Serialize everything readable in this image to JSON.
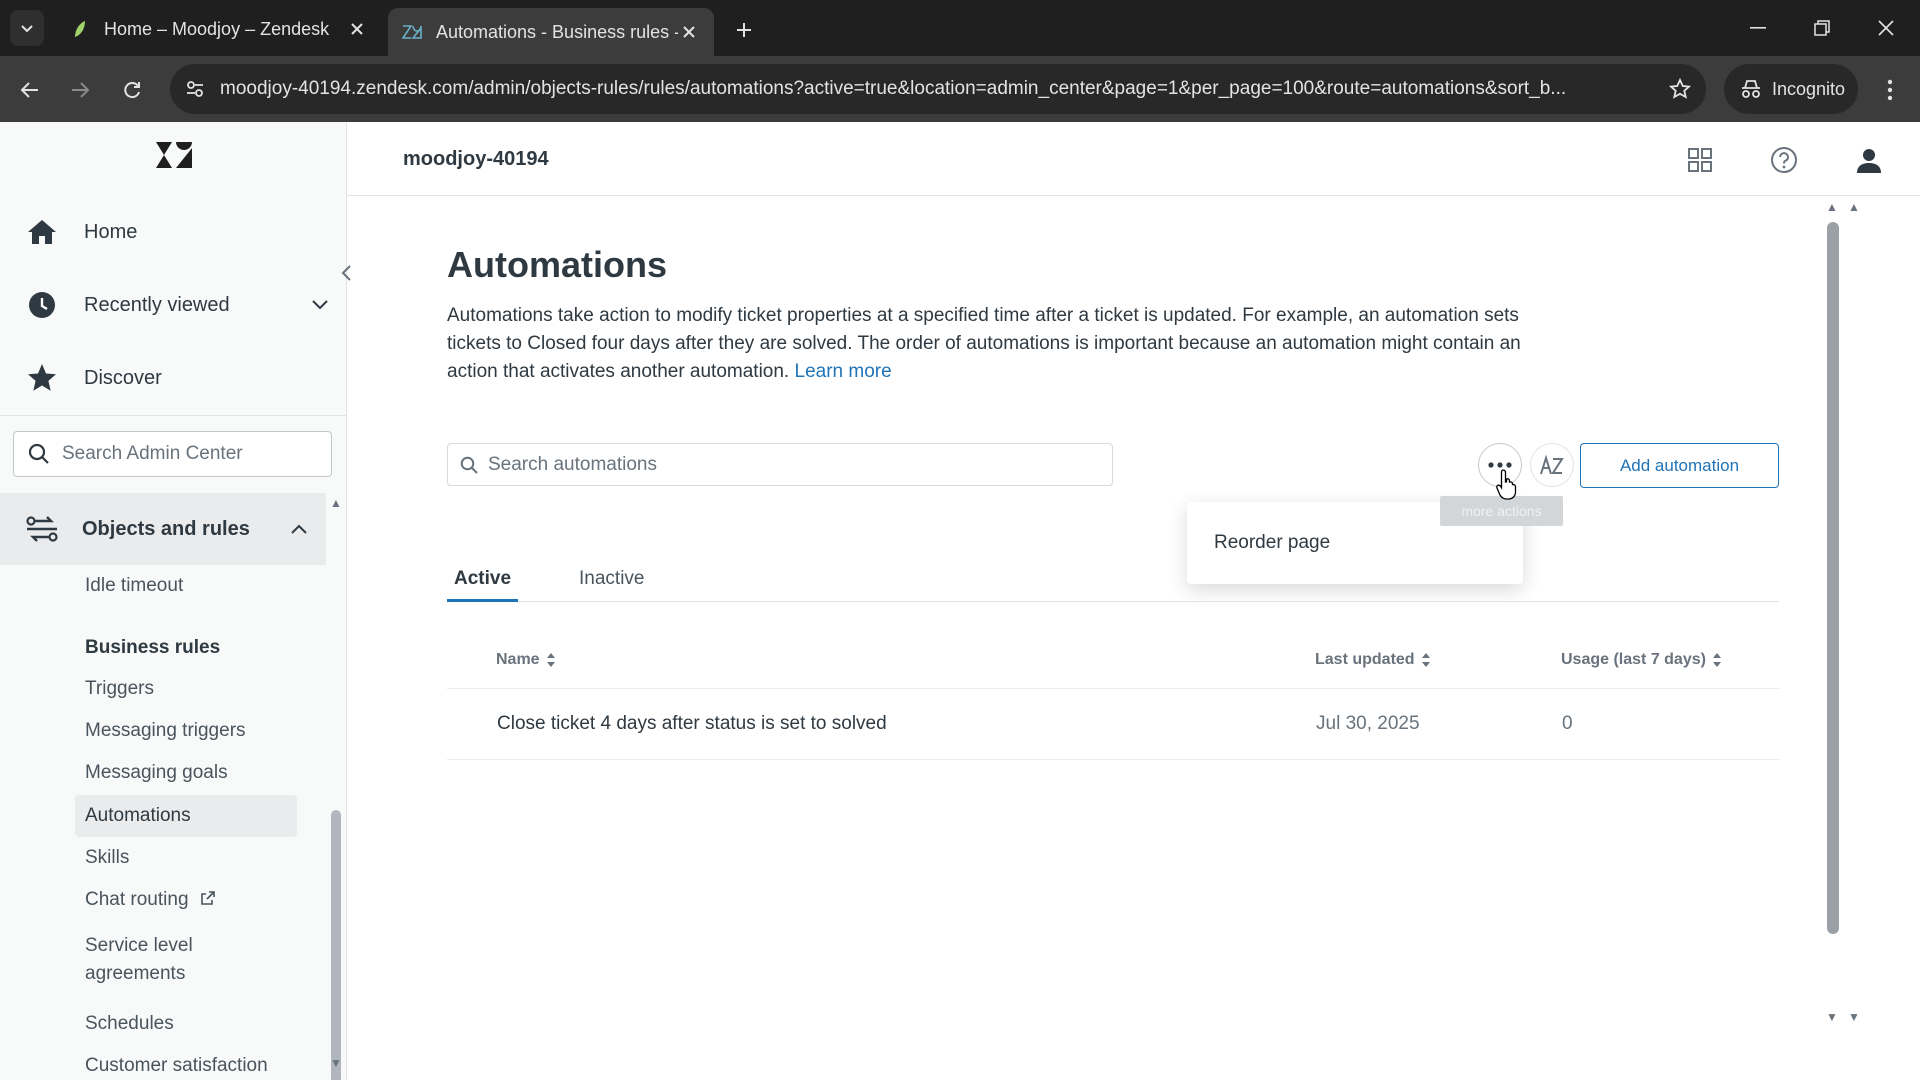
{
  "browser": {
    "tabs": [
      {
        "title": "Home – Moodjoy – Zendesk"
      },
      {
        "title": "Automations - Business rules -"
      }
    ],
    "url": "moodjoy-40194.zendesk.com/admin/objects-rules/rules/automations?active=true&location=admin_center&page=1&per_page=100&route=automations&sort_b...",
    "incognito_label": "Incognito"
  },
  "sidebar": {
    "nav": [
      {
        "label": "Home"
      },
      {
        "label": "Recently viewed"
      },
      {
        "label": "Discover"
      }
    ],
    "search_placeholder": "Search Admin Center",
    "section_title": "Objects and rules",
    "items": [
      {
        "label": "Idle timeout"
      },
      {
        "label": "Business rules"
      },
      {
        "label": "Triggers"
      },
      {
        "label": "Messaging triggers"
      },
      {
        "label": "Messaging goals"
      },
      {
        "label": "Automations"
      },
      {
        "label": "Skills"
      },
      {
        "label": "Chat routing"
      },
      {
        "label": "Service level agreements"
      },
      {
        "label": "Schedules"
      },
      {
        "label": "Customer satisfaction"
      }
    ]
  },
  "header": {
    "account": "moodjoy-40194"
  },
  "page": {
    "title": "Automations",
    "description": "Automations take action to modify ticket properties at a specified time after a ticket is updated. For example, an automation sets tickets to Closed four days after they are solved. The order of automations is important because an automation might contain an action that activates another automation.",
    "learn_more": "Learn more",
    "search_placeholder": "Search automations",
    "add_button": "Add automation",
    "tooltip": "more actions",
    "menu_item": "Reorder page",
    "tabs": [
      {
        "label": "Active"
      },
      {
        "label": "Inactive"
      }
    ],
    "columns": [
      {
        "label": "Name"
      },
      {
        "label": "Last updated"
      },
      {
        "label": "Usage (last 7 days)"
      }
    ],
    "rows": [
      {
        "name": "Close ticket 4 days after status is set to solved",
        "updated": "Jul 30, 2025",
        "usage": "0"
      }
    ]
  },
  "colors": {
    "accent": "#1f73b7",
    "sidebar_bg": "#f8f9f9",
    "selected_bg": "#e9ebed",
    "chrome_dark": "#1f1f1f"
  }
}
